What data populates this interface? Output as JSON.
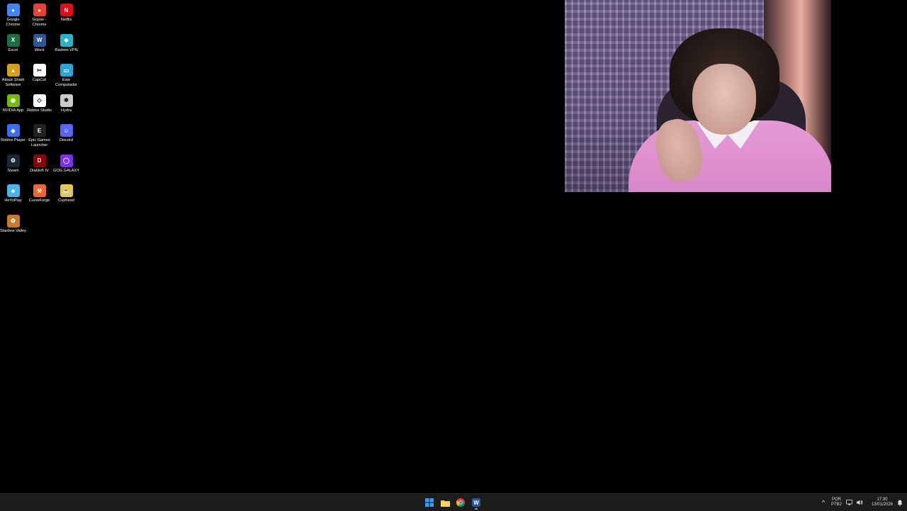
{
  "desktop_icons": [
    {
      "label": "Google Chrome",
      "icon": "chrome-icon",
      "color": "#4285f4",
      "glyph": "●"
    },
    {
      "label": "Gojow - Chrome",
      "icon": "chrome-profile-icon",
      "color": "#ea4335",
      "glyph": "●"
    },
    {
      "label": "Netflix",
      "icon": "netflix-icon",
      "color": "#e50914",
      "glyph": "N"
    },
    {
      "label": "Excel",
      "icon": "excel-icon",
      "color": "#1d6f42",
      "glyph": "X"
    },
    {
      "label": "Word",
      "icon": "word-icon",
      "color": "#2b579a",
      "glyph": "W"
    },
    {
      "label": "Radmin VPN",
      "icon": "radmin-vpn-icon",
      "color": "#27b4c8",
      "glyph": "◆"
    },
    {
      "label": "Attack Shark Software",
      "icon": "attack-shark-icon",
      "color": "#d4a017",
      "glyph": "▲"
    },
    {
      "label": "CapCut",
      "icon": "capcut-icon",
      "color": "#ffffff",
      "glyph": "✂"
    },
    {
      "label": "Este Computador",
      "icon": "this-pc-icon",
      "color": "#2aa7d8",
      "glyph": "▭"
    },
    {
      "label": "NVIDIA App",
      "icon": "nvidia-icon",
      "color": "#76b900",
      "glyph": "◉"
    },
    {
      "label": "Roblox Studio",
      "icon": "roblox-studio-icon",
      "color": "#ffffff",
      "glyph": "◇"
    },
    {
      "label": "Hydra",
      "icon": "hydra-icon",
      "color": "#cccccc",
      "glyph": "✱"
    },
    {
      "label": "Roblox Player",
      "icon": "roblox-player-icon",
      "color": "#3a6df0",
      "glyph": "◆"
    },
    {
      "label": "Epic Games Launcher",
      "icon": "epic-games-icon",
      "color": "#222222",
      "glyph": "E"
    },
    {
      "label": "Discord",
      "icon": "discord-icon",
      "color": "#5865f2",
      "glyph": "☺"
    },
    {
      "label": "Steam",
      "icon": "steam-icon",
      "color": "#1b2838",
      "glyph": "⚙"
    },
    {
      "label": "Diablo® IV",
      "icon": "diablo-icon",
      "color": "#8b0000",
      "glyph": "D"
    },
    {
      "label": "GOG GALAXY",
      "icon": "gog-galaxy-icon",
      "color": "#7b2ff7",
      "glyph": "◯"
    },
    {
      "label": "HoYoPlay",
      "icon": "hoyoplay-icon",
      "color": "#4ab3e8",
      "glyph": "☻"
    },
    {
      "label": "CurseForge",
      "icon": "curseforge-icon",
      "color": "#f16436",
      "glyph": "⚒"
    },
    {
      "label": "Cuphead",
      "icon": "cuphead-icon",
      "color": "#e6c84a",
      "glyph": "☕"
    },
    {
      "label": "Stardew Valley",
      "icon": "stardew-valley-icon",
      "color": "#c97b2d",
      "glyph": "✿"
    }
  ],
  "taskbar": {
    "apps": [
      {
        "name": "start-button",
        "icon": "windows-logo-icon",
        "color": "#3a9bf4"
      },
      {
        "name": "taskbar-file-explorer",
        "icon": "folder-icon",
        "color": "#f0c24b"
      },
      {
        "name": "taskbar-chrome",
        "icon": "chrome-icon",
        "color": "#4285f4"
      },
      {
        "name": "taskbar-word",
        "icon": "word-icon",
        "color": "#2b579a"
      }
    ],
    "tray": {
      "chevron": "^",
      "lang_top": "POR",
      "lang_bottom": "PTB2",
      "time": "17:30",
      "date": "13/01/2026"
    }
  }
}
